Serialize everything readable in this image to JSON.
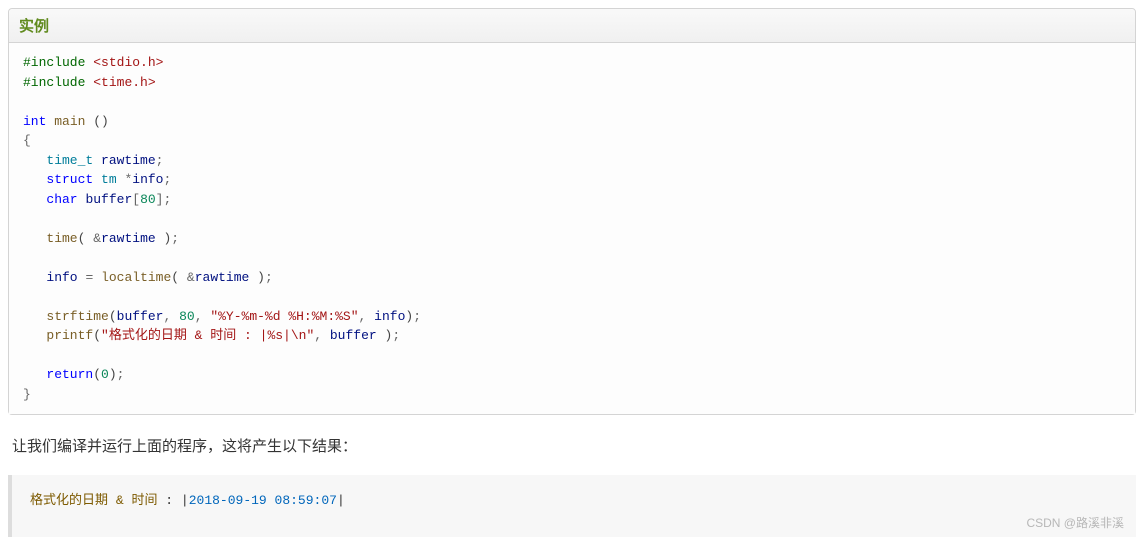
{
  "example": {
    "title": "实例",
    "code": {
      "include1_directive": "#include",
      "include1_header": "<stdio.h>",
      "include2_directive": "#include",
      "include2_header": "<time.h>",
      "kw_int": "int",
      "fn_main": "main",
      "empty_parens": "()",
      "brace_open": "{",
      "type_time_t": "time_t",
      "var_rawtime": "rawtime",
      "semi": ";",
      "kw_struct": "struct",
      "type_tm": "tm",
      "star": "*",
      "var_info": "info",
      "kw_char": "char",
      "var_buffer": "buffer",
      "bracket_open": "[",
      "num_80": "80",
      "bracket_close": "]",
      "fn_time": "time",
      "paren_open": "(",
      "amp": "&",
      "paren_close": ")",
      "eq": "=",
      "fn_localtime": "localtime",
      "fn_strftime": "strftime",
      "comma": ",",
      "str_fmt": "\"%Y-%m-%d %H:%M:%S\"",
      "fn_printf": "printf",
      "str_printf": "\"格式化的日期 & 时间 : |%s|\\n\"",
      "kw_return": "return",
      "num_0": "0",
      "brace_close": "}"
    }
  },
  "description": "让我们编译并运行上面的程序，这将产生以下结果：",
  "output": {
    "label": "格式化的日期",
    "amp": "&",
    "label2": "时间",
    "colon": ":",
    "pipe": "|",
    "date_value": "2018-09-19 08:59:07"
  },
  "watermark": "CSDN @路溪非溪"
}
